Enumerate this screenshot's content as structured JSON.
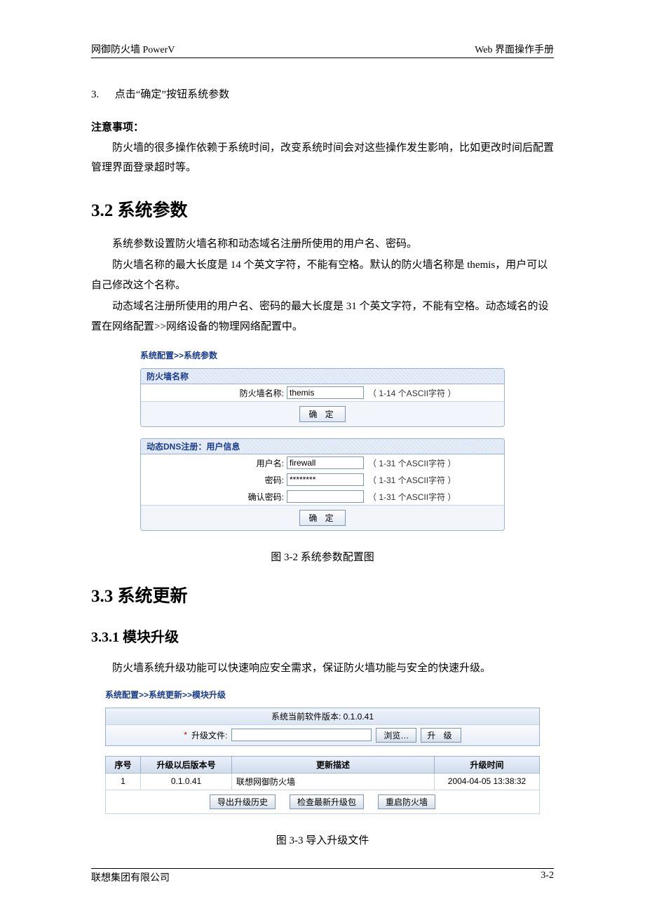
{
  "header": {
    "left": "网御防火墙 PowerV",
    "right": "Web 界面操作手册"
  },
  "step": {
    "num": "3.",
    "text": "点击“确定”按钮系统参数"
  },
  "note": {
    "title": "注意事项：",
    "body": "防火墙的很多操作依赖于系统时间，改变系统时间会对这些操作发生影响，比如更改时间后配置管理界面登录超时等。"
  },
  "s32": {
    "heading": "3.2 系统参数",
    "p1": "系统参数设置防火墙名称和动态域名注册所使用的用户名、密码。",
    "p2": "防火墙名称的最大长度是 14 个英文字符，不能有空格。默认的防火墙名称是 themis，用户可以自己修改这个名称。",
    "p3": "动态域名注册所使用的用户名、密码的最大长度是 31 个英文字符，不能有空格。动态域名的设置在网络配置>>网络设备的物理网络配置中。"
  },
  "panel1": {
    "breadcrumb": "系统配置>>系统参数",
    "box1": {
      "title": "防火墙名称",
      "label": "防火墙名称:",
      "value": "themis",
      "hint": "（ 1-14 个ASCII字符 ）",
      "button": "确 定"
    },
    "box2": {
      "title": "动态DNS注册：用户信息",
      "row1": {
        "label": "用户名:",
        "value": "firewall",
        "hint": "（ 1-31 个ASCII字符 ）"
      },
      "row2": {
        "label": "密码:",
        "value": "********",
        "hint": "（ 1-31 个ASCII字符 ）"
      },
      "row3": {
        "label": "确认密码:",
        "value": "",
        "hint": "（ 1-31 个ASCII字符 ）"
      },
      "button": "确 定"
    }
  },
  "caption1": "图 3-2 系统参数配置图",
  "s33": {
    "heading": "3.3 系统更新"
  },
  "s331": {
    "heading": "3.3.1  模块升级",
    "p1": "防火墙系统升级功能可以快速响应安全需求，保证防火墙功能与安全的快速升级。"
  },
  "panel2": {
    "breadcrumb": "系统配置>>系统更新>>模块升级",
    "version_label": "系统当前软件版本: 0.1.0.41",
    "upload": {
      "star": "*",
      "label": "升级文件:",
      "browse": "浏览…",
      "submit": "升 级"
    },
    "table": {
      "headers": [
        "序号",
        "升级以后版本号",
        "更新描述",
        "升级时间"
      ],
      "row": [
        "1",
        "0.1.0.41",
        "联想网御防火墙",
        "2004-04-05 13:38:32"
      ]
    },
    "buttons": [
      "导出升级历史",
      "检查最新升级包",
      "重启防火墙"
    ]
  },
  "caption2": "图 3-3 导入升级文件",
  "footer": {
    "left": "联想集团有限公司",
    "right": "3-2"
  }
}
